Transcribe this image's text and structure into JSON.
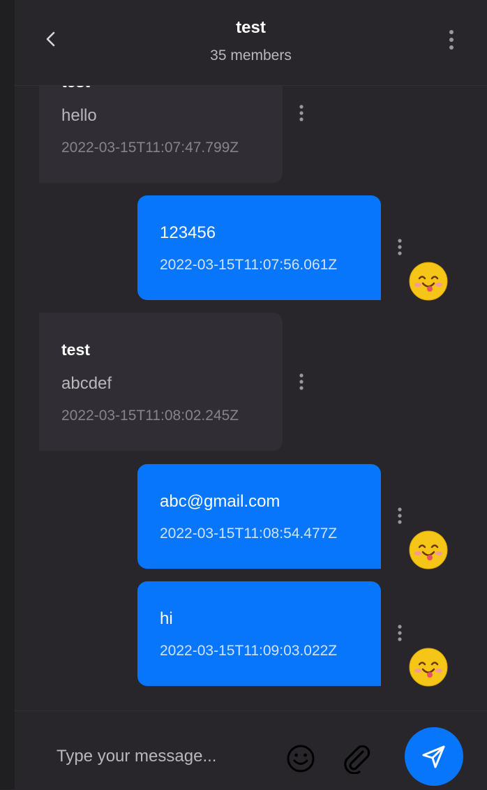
{
  "header": {
    "title": "test",
    "subtitle": "35 members",
    "back_icon": "chevron-left-icon",
    "menu_icon": "more-vertical-icon"
  },
  "messages": [
    {
      "direction": "incoming",
      "sender": "test",
      "text": "hello",
      "time": "2022-03-15T11:07:47.799Z"
    },
    {
      "direction": "outgoing",
      "text": "123456",
      "time": "2022-03-15T11:07:56.061Z",
      "avatar_icon": "smiley-avatar-icon"
    },
    {
      "direction": "incoming",
      "sender": "test",
      "text": "abcdef",
      "time": "2022-03-15T11:08:02.245Z"
    },
    {
      "direction": "outgoing",
      "text": "abc@gmail.com",
      "time": "2022-03-15T11:08:54.477Z",
      "avatar_icon": "smiley-avatar-icon"
    },
    {
      "direction": "outgoing",
      "text": "hi",
      "time": "2022-03-15T11:09:03.022Z",
      "avatar_icon": "smiley-avatar-icon"
    }
  ],
  "composer": {
    "placeholder": "Type your message...",
    "value": "",
    "emoji_icon": "emoji-smile-icon",
    "attach_icon": "paperclip-icon",
    "send_icon": "send-icon"
  },
  "colors": {
    "background": "#28262b",
    "incoming_bubble": "#302e34",
    "outgoing_bubble": "#0776fb",
    "send_button": "#0776fb"
  }
}
